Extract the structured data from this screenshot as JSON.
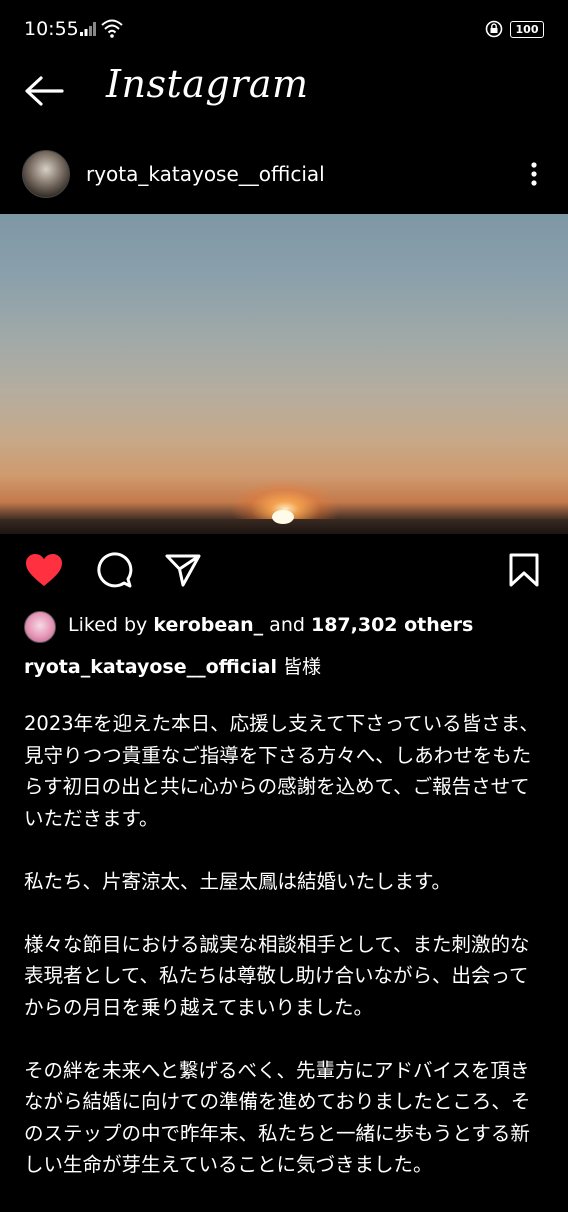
{
  "status_bar": {
    "time": "10:55",
    "battery": "100"
  },
  "header": {
    "app_title": "Instagram"
  },
  "post": {
    "username": "ryota_katayose__official",
    "liked_by_prefix": "Liked by",
    "liked_by_user": "kerobean_",
    "liked_by_and": "and",
    "liked_by_count": "187,302 others",
    "caption_user": "ryota_katayose__official",
    "caption_first": "皆様",
    "caption_paragraphs": [
      "2023年を迎えた本日、応援し支えて下さっている皆さま、見守りつつ貴重なご指導を下さる方々へ、しあわせをもたらす初日の出と共に心からの感謝を込めて、ご報告させていただきます。",
      "私たち、片寄涼太、土屋太鳳は結婚いたします。",
      "様々な節目における誠実な相談相手として、また刺激的な表現者として、私たちは尊敬し助け合いながら、出会ってからの月日を乗り越えてまいりました。",
      "その絆を未来へと繋げるべく、先輩方にアドバイスを頂きながら結婚に向けての準備を進めておりましたところ、そのステップの中で昨年末、私たちと一緒に歩もうとする新しい生命が芽生えていることに気づきました。"
    ]
  },
  "colors": {
    "background": "#000000",
    "like_red": "#ff3040",
    "text": "#ffffff"
  },
  "icons": [
    "back-arrow-icon",
    "more-options-icon",
    "heart-icon",
    "comment-icon",
    "share-icon",
    "bookmark-icon"
  ]
}
